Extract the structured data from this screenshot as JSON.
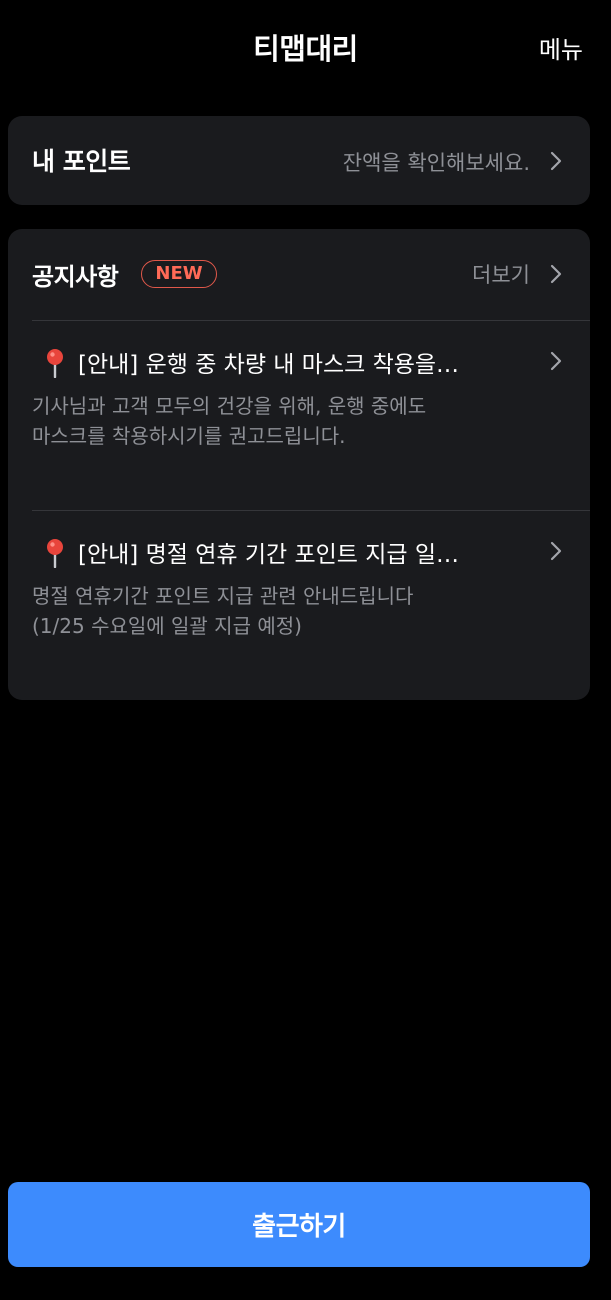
{
  "header": {
    "title": "티맵대리",
    "menu_label": "메뉴"
  },
  "points": {
    "title": "내 포인트",
    "hint": "잔액을 확인해보세요."
  },
  "notices": {
    "title": "공지사항",
    "badge": "NEW",
    "more_label": "더보기",
    "items": [
      {
        "title": "[안내] 운행 중 차량 내 마스크 착용을…",
        "desc_line1": "기사님과 고객 모두의 건강을 위해, 운행 중에도",
        "desc_line2": "마스크를 착용하시기를 권고드립니다."
      },
      {
        "title": "[안내] 명절 연휴 기간 포인트 지급 일…",
        "desc_line1": "명절 연휴기간 포인트 지급 관련 안내드립니다",
        "desc_line2": "(1/25 수요일에 일괄 지급 예정)"
      }
    ]
  },
  "cta": {
    "label": "출근하기"
  },
  "colors": {
    "background": "#000000",
    "card": "#1a1b1e",
    "muted_text": "#8e9096",
    "new_badge": "#ff6a57",
    "primary_button": "#3d8bfd",
    "pin": "#e8453c"
  },
  "icons": {
    "chevron": "chevron-right-icon",
    "pin": "map-pin-icon"
  }
}
